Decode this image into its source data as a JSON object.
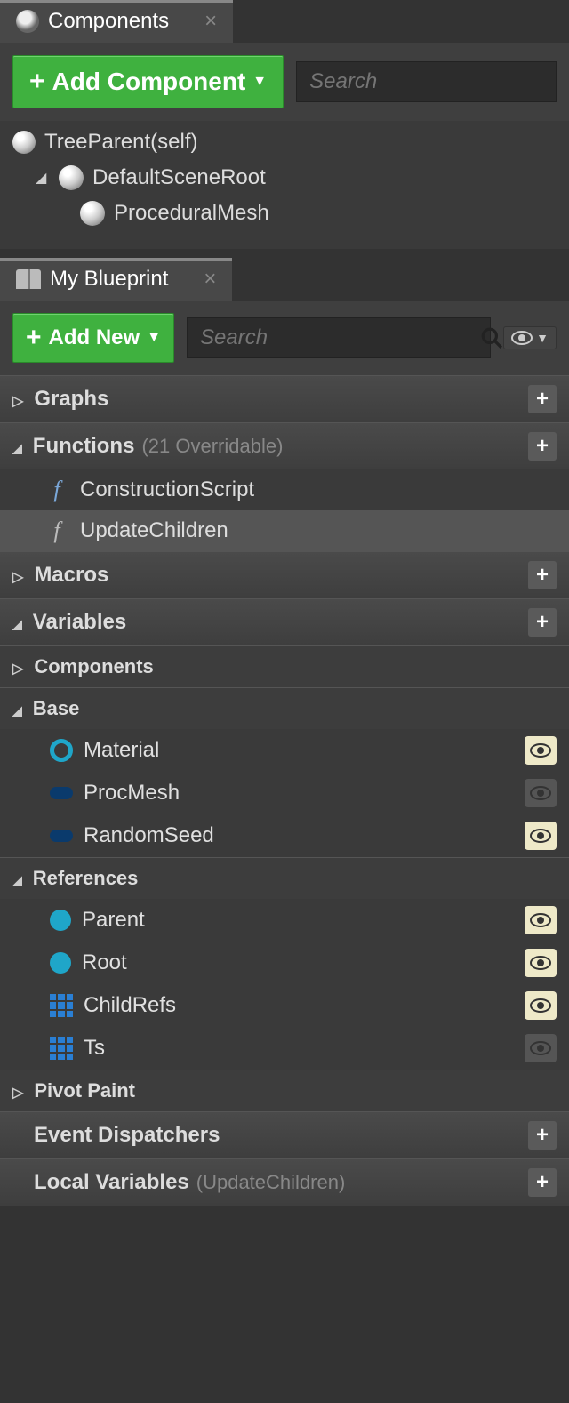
{
  "components": {
    "tab_title": "Components",
    "add_button": "Add Component",
    "search_placeholder": "Search",
    "tree": {
      "root": "TreeParent(self)",
      "scene_root": "DefaultSceneRoot",
      "child1": "ProceduralMesh"
    }
  },
  "myblueprint": {
    "tab_title": "My Blueprint",
    "add_button": "Add New",
    "search_placeholder": "Search",
    "sections": {
      "graphs": "Graphs",
      "functions": "Functions",
      "functions_extra": "(21 Overridable)",
      "macros": "Macros",
      "variables": "Variables",
      "event_dispatchers": "Event Dispatchers",
      "local_variables": "Local Variables",
      "local_variables_extra": "(UpdateChildren)"
    },
    "functions": {
      "construction": "ConstructionScript",
      "update_children": "UpdateChildren"
    },
    "var_categories": {
      "components": "Components",
      "base": "Base",
      "references": "References",
      "pivot_paint": "Pivot Paint"
    },
    "vars": {
      "material": "Material",
      "procmesh": "ProcMesh",
      "randomseed": "RandomSeed",
      "parent": "Parent",
      "root": "Root",
      "childrefs": "ChildRefs",
      "ts": "Ts"
    }
  }
}
